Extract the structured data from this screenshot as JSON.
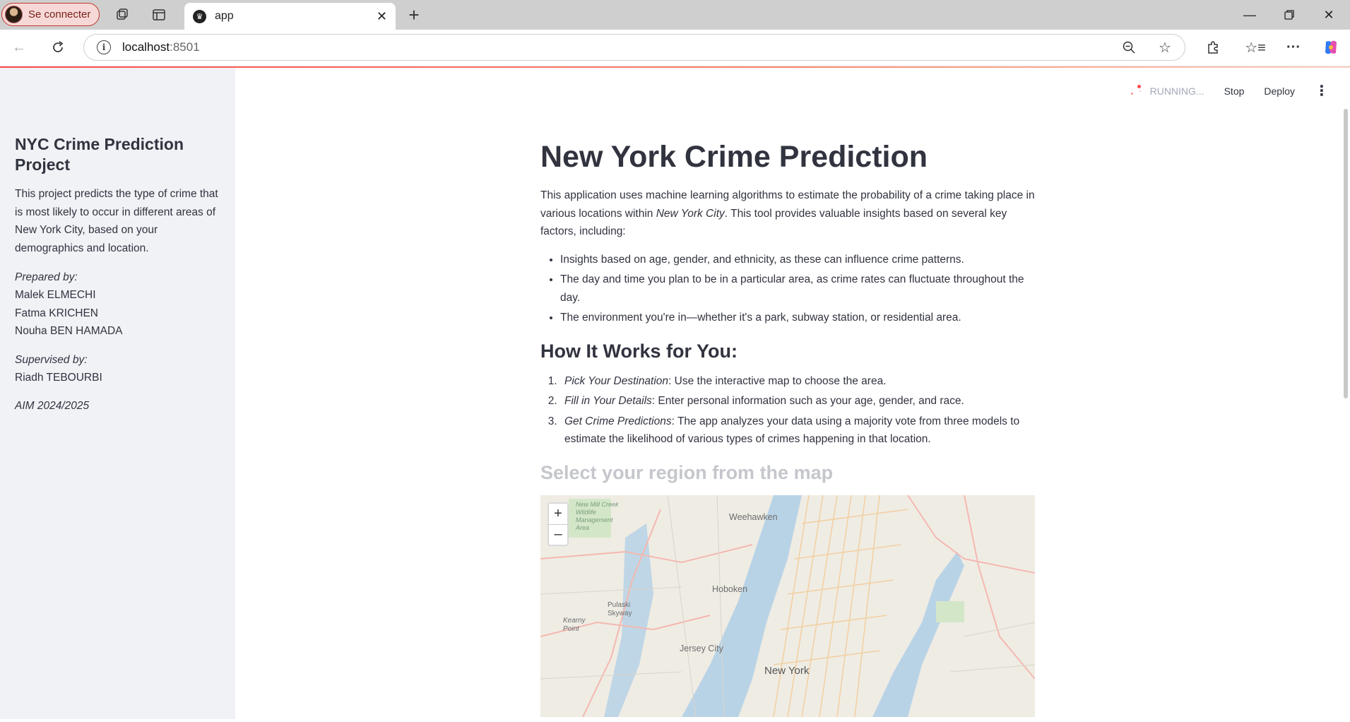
{
  "browser": {
    "profile_label": "Se connecter",
    "tab_title": "app",
    "url_host": "localhost",
    "url_port": ":8501"
  },
  "toolbar": {
    "status": "RUNNING...",
    "stop_label": "Stop",
    "deploy_label": "Deploy"
  },
  "sidebar": {
    "title": "NYC Crime Prediction Project",
    "description": "This project predicts the type of crime that is most likely to occur in different areas of New York City, based on your demographics and location.",
    "prepared_label": "Prepared by:",
    "authors": [
      "Malek ELMECHI",
      "Fatma KRICHEN",
      "Nouha BEN HAMADA"
    ],
    "supervised_label": "Supervised by:",
    "supervisor": "Riadh TEBOURBI",
    "year": "AIM 2024/2025"
  },
  "main": {
    "title": "New York Crime Prediction",
    "intro_before": "This application uses machine learning algorithms to estimate the probability of a crime taking place in various locations within ",
    "intro_city": "New York City",
    "intro_after": ". This tool provides valuable insights based on several key factors, including:",
    "bullets": [
      "Insights based on age, gender, and ethnicity, as these can influence crime patterns.",
      "The day and time you plan to be in a particular area, as crime rates can fluctuate throughout the day.",
      "The environment you're in—whether it's a park, subway station, or residential area."
    ],
    "how_title": "How It Works for You:",
    "steps": [
      {
        "title": "Pick Your Destination",
        "text": ": Use the interactive map to choose the area."
      },
      {
        "title": "Fill in Your Details",
        "text": ": Enter personal information such as your age, gender, and race."
      },
      {
        "title": "Get Crime Predictions",
        "text": ": The app analyzes your data using a majority vote from three models to estimate the likelihood of various types of crimes happening in that location."
      }
    ],
    "map_title": "Select your region from the map",
    "map": {
      "zoom_in": "+",
      "zoom_out": "–",
      "labels": [
        "Weehawken",
        "Hoboken",
        "Pulaski Skyway",
        "Jersey City",
        "New York",
        "Kearny Point",
        "New Mill Creek Wildlife Management Area"
      ]
    }
  }
}
